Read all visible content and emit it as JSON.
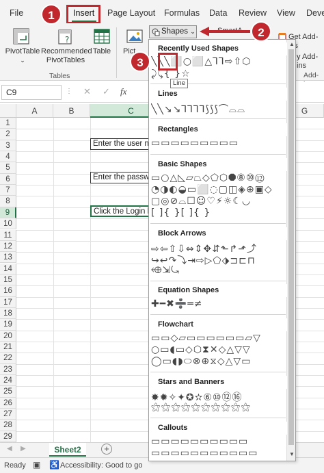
{
  "tabs": [
    "File",
    "Insert",
    "Page Layout",
    "Formulas",
    "Data",
    "Review",
    "View",
    "Deve"
  ],
  "ribbon": {
    "buttons": [
      "PivotTable",
      "Recommended PivotTables",
      "Table",
      "Pict"
    ],
    "group_label": "Tables",
    "shapes_label": "Shapes",
    "smartart_label": "SmartA",
    "get_addins": "Get Add-ins",
    "my_addins": "y Add-ins",
    "addins_group": "Add-ins"
  },
  "formula_bar": {
    "name_box": "C9",
    "fx": "fx"
  },
  "grid": {
    "columns": [
      "A",
      "B",
      "C",
      "G"
    ],
    "selected_column": "C",
    "rows": [
      "1",
      "2",
      "3",
      "4",
      "5",
      "6",
      "7",
      "8",
      "9",
      "10",
      "11",
      "12",
      "13",
      "14",
      "15",
      "16",
      "17",
      "18",
      "19",
      "20",
      "21",
      "22",
      "23",
      "24",
      "25",
      "26",
      "27",
      "28",
      "29"
    ],
    "selected_row": "9",
    "cells": {
      "c3": "Enter the user na",
      "c6": "Enter the passwo",
      "c9": "Click the Login b"
    }
  },
  "sheet_tab": "Sheet2",
  "status": {
    "ready": "Ready",
    "accessibility": "Accessibility: Good to go"
  },
  "gallery": {
    "sections": [
      "Recently Used Shapes",
      "Lines",
      "Rectangles",
      "Basic Shapes",
      "Block Arrows",
      "Equation Shapes",
      "Flowchart",
      "Stars and Banners",
      "Callouts"
    ],
    "rows": [
      "╲╲╲⬜○⬜△⅂⅂⇨⇧⬡",
      "⤸⤹{ }☆",
      "╲╲↘↘⅂⅂⅂⅂⟆⟆⟆⌒⌓⌓",
      "▭▭▭▭▭▭▭▭▭",
      "▭○△◺▱⏢◇⬠⬡⯃⑧⑩⑫",
      "◔◑◐◒▭⬜◌▢◫◈⊕▣◇",
      "▢◎⊘⌓☐☺♡⚡☼☾◡",
      "[ ]{ }[ ]{ }",
      "⇨⇦⇧⇩⇔⇕✥⇵⬑↱⬏⤴",
      "↪↩↷⤵⇥⇨▷⬠⬗⊐⊏⊓",
      "⬲⇲⤿",
      "✚━✖➗═≠",
      "▭▭◇▱▭▭▭▭▭▭▱▽",
      "○▭◖▭◇⬡⧗✕◇△▽▽",
      "◯▭◖◗⬭⊗⊕⧖◇△▽▭",
      "✸✹✧✦✪✫⑥⑩⑫⑯",
      "⚝⚝⚝⚝⚝⚝⚝⚝⚝⚝",
      "▭▭▭▭▭▭▭▭▭▭",
      "▭▭▭▭▭▭▭▭▭▭▭"
    ],
    "tooltip": "Line"
  },
  "badges": [
    "1",
    "2",
    "3"
  ],
  "colors": {
    "accent": "#217346",
    "highlight": "#c0282d"
  }
}
